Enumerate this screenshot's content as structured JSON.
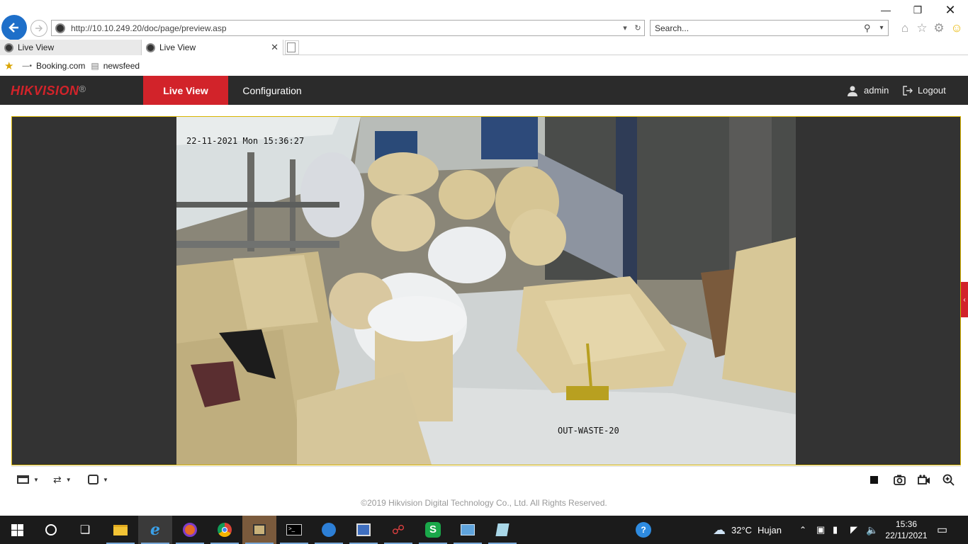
{
  "browser": {
    "address_url": "http://10.10.249.20/doc/page/preview.asp",
    "search_placeholder": "Search...",
    "tabs": [
      {
        "label": "Live View",
        "active": false
      },
      {
        "label": "Live View",
        "active": true
      }
    ],
    "favorites": [
      {
        "label": "Booking.com"
      },
      {
        "label": "newsfeed"
      }
    ]
  },
  "app": {
    "brand": "HIKVISION",
    "brand_mark": "®",
    "brand_color": "#d2232a",
    "nav": [
      {
        "label": "Live View",
        "active": true
      },
      {
        "label": "Configuration",
        "active": false
      }
    ],
    "user": "admin",
    "logout": "Logout"
  },
  "video": {
    "timestamp": "22-11-2021 Mon 15:36:27",
    "camera_name": "OUT-WASTE-20"
  },
  "footer": {
    "copyright": "©2019 Hikvision Digital Technology Co., Ltd. All Rights Reserved."
  },
  "taskbar": {
    "weather_temp": "32°C",
    "weather_desc": "Hujan",
    "time": "15:36",
    "date": "22/11/2021"
  }
}
